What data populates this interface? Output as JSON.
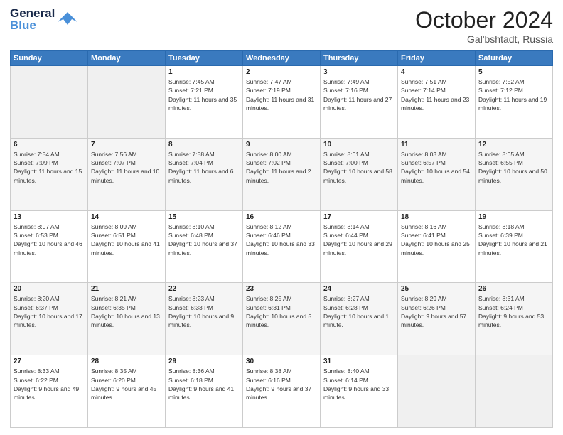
{
  "header": {
    "logo_line1": "General",
    "logo_line2": "Blue",
    "month": "October 2024",
    "location": "Gal'bshtadt, Russia"
  },
  "days_of_week": [
    "Sunday",
    "Monday",
    "Tuesday",
    "Wednesday",
    "Thursday",
    "Friday",
    "Saturday"
  ],
  "weeks": [
    [
      {
        "day": "",
        "empty": true
      },
      {
        "day": "",
        "empty": true
      },
      {
        "day": "1",
        "sunrise": "7:45 AM",
        "sunset": "7:21 PM",
        "daylight": "11 hours and 35 minutes."
      },
      {
        "day": "2",
        "sunrise": "7:47 AM",
        "sunset": "7:19 PM",
        "daylight": "11 hours and 31 minutes."
      },
      {
        "day": "3",
        "sunrise": "7:49 AM",
        "sunset": "7:16 PM",
        "daylight": "11 hours and 27 minutes."
      },
      {
        "day": "4",
        "sunrise": "7:51 AM",
        "sunset": "7:14 PM",
        "daylight": "11 hours and 23 minutes."
      },
      {
        "day": "5",
        "sunrise": "7:52 AM",
        "sunset": "7:12 PM",
        "daylight": "11 hours and 19 minutes."
      }
    ],
    [
      {
        "day": "6",
        "sunrise": "7:54 AM",
        "sunset": "7:09 PM",
        "daylight": "11 hours and 15 minutes."
      },
      {
        "day": "7",
        "sunrise": "7:56 AM",
        "sunset": "7:07 PM",
        "daylight": "11 hours and 10 minutes."
      },
      {
        "day": "8",
        "sunrise": "7:58 AM",
        "sunset": "7:04 PM",
        "daylight": "11 hours and 6 minutes."
      },
      {
        "day": "9",
        "sunrise": "8:00 AM",
        "sunset": "7:02 PM",
        "daylight": "11 hours and 2 minutes."
      },
      {
        "day": "10",
        "sunrise": "8:01 AM",
        "sunset": "7:00 PM",
        "daylight": "10 hours and 58 minutes."
      },
      {
        "day": "11",
        "sunrise": "8:03 AM",
        "sunset": "6:57 PM",
        "daylight": "10 hours and 54 minutes."
      },
      {
        "day": "12",
        "sunrise": "8:05 AM",
        "sunset": "6:55 PM",
        "daylight": "10 hours and 50 minutes."
      }
    ],
    [
      {
        "day": "13",
        "sunrise": "8:07 AM",
        "sunset": "6:53 PM",
        "daylight": "10 hours and 46 minutes."
      },
      {
        "day": "14",
        "sunrise": "8:09 AM",
        "sunset": "6:51 PM",
        "daylight": "10 hours and 41 minutes."
      },
      {
        "day": "15",
        "sunrise": "8:10 AM",
        "sunset": "6:48 PM",
        "daylight": "10 hours and 37 minutes."
      },
      {
        "day": "16",
        "sunrise": "8:12 AM",
        "sunset": "6:46 PM",
        "daylight": "10 hours and 33 minutes."
      },
      {
        "day": "17",
        "sunrise": "8:14 AM",
        "sunset": "6:44 PM",
        "daylight": "10 hours and 29 minutes."
      },
      {
        "day": "18",
        "sunrise": "8:16 AM",
        "sunset": "6:41 PM",
        "daylight": "10 hours and 25 minutes."
      },
      {
        "day": "19",
        "sunrise": "8:18 AM",
        "sunset": "6:39 PM",
        "daylight": "10 hours and 21 minutes."
      }
    ],
    [
      {
        "day": "20",
        "sunrise": "8:20 AM",
        "sunset": "6:37 PM",
        "daylight": "10 hours and 17 minutes."
      },
      {
        "day": "21",
        "sunrise": "8:21 AM",
        "sunset": "6:35 PM",
        "daylight": "10 hours and 13 minutes."
      },
      {
        "day": "22",
        "sunrise": "8:23 AM",
        "sunset": "6:33 PM",
        "daylight": "10 hours and 9 minutes."
      },
      {
        "day": "23",
        "sunrise": "8:25 AM",
        "sunset": "6:31 PM",
        "daylight": "10 hours and 5 minutes."
      },
      {
        "day": "24",
        "sunrise": "8:27 AM",
        "sunset": "6:28 PM",
        "daylight": "10 hours and 1 minute."
      },
      {
        "day": "25",
        "sunrise": "8:29 AM",
        "sunset": "6:26 PM",
        "daylight": "9 hours and 57 minutes."
      },
      {
        "day": "26",
        "sunrise": "8:31 AM",
        "sunset": "6:24 PM",
        "daylight": "9 hours and 53 minutes."
      }
    ],
    [
      {
        "day": "27",
        "sunrise": "8:33 AM",
        "sunset": "6:22 PM",
        "daylight": "9 hours and 49 minutes."
      },
      {
        "day": "28",
        "sunrise": "8:35 AM",
        "sunset": "6:20 PM",
        "daylight": "9 hours and 45 minutes."
      },
      {
        "day": "29",
        "sunrise": "8:36 AM",
        "sunset": "6:18 PM",
        "daylight": "9 hours and 41 minutes."
      },
      {
        "day": "30",
        "sunrise": "8:38 AM",
        "sunset": "6:16 PM",
        "daylight": "9 hours and 37 minutes."
      },
      {
        "day": "31",
        "sunrise": "8:40 AM",
        "sunset": "6:14 PM",
        "daylight": "9 hours and 33 minutes."
      },
      {
        "day": "",
        "empty": true
      },
      {
        "day": "",
        "empty": true
      }
    ]
  ]
}
